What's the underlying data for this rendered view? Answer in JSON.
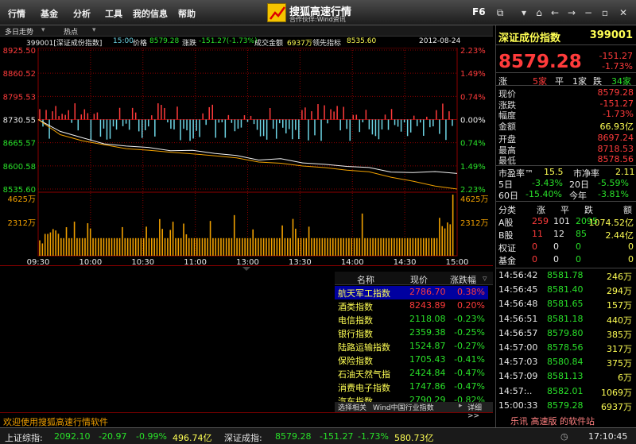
{
  "menu": [
    "行情",
    "基金",
    "分析",
    "工具",
    "我的信息",
    "帮助"
  ],
  "logo": {
    "name": "搜狐高速行情",
    "sub": "合作伙伴:Wind资讯"
  },
  "toolbar": {
    "f6": "F6"
  },
  "chart_header": {
    "tabs": [
      "多日走势",
      "热点"
    ]
  },
  "info": {
    "code_name": "399001[深证成份指数]",
    "time": "15:00",
    "price_label": "价格",
    "price": "8579.28",
    "change_label": "涨跌",
    "change": "-151.27(-1.73%)",
    "amount_label": "成交金额",
    "amount": "6937万",
    "lead_label": "领先指标",
    "lead": "8535.60",
    "date": "2012-08-24"
  },
  "chart_data": {
    "type": "line",
    "title": "",
    "xlabel": "",
    "ylabel": "",
    "y_ticks_left": [
      "8925.50",
      "8860.52",
      "8795.53",
      "8730.55",
      "8665.57",
      "8600.58",
      "8535.60"
    ],
    "y_ticks_right": [
      "2.23%",
      "1.49%",
      "0.74%",
      "0.00%",
      "0.74%",
      "1.49%",
      "2.23%"
    ],
    "ylim": [
      8535.6,
      8925.5
    ],
    "prev_close": 8730.55,
    "x_ticks": [
      "09:30",
      "10:00",
      "10:30",
      "11:00",
      "13:00",
      "13:30",
      "14:00",
      "14:30",
      "15:00"
    ],
    "volume_ticks": [
      "4625万",
      "2312万"
    ],
    "volume_ticks_right": [
      "4625万",
      "2312万"
    ],
    "volume_max": 6937,
    "series": [
      {
        "values": [
          8730.6,
          8697.3,
          8679.6,
          8662.4,
          8656.1,
          8652.3,
          8642.9,
          8644.3,
          8635.7,
          8629.7,
          8617.0,
          8620.6,
          8608.8,
          8604.9,
          8599.0,
          8596.0,
          8583.3,
          8582.0,
          8584.7,
          8579.3
        ]
      },
      {
        "values": [
          8730.6,
          8688.2,
          8671.0,
          8659.9,
          8648.7,
          8644.6,
          8638.9,
          8634.4,
          8628.9,
          8622.9,
          8611.4,
          8607.9,
          8600.2,
          8595.7,
          8588.6,
          8583.9,
          8568.7,
          8557.7,
          8543.9,
          8535.6
        ]
      }
    ],
    "volume": [
      1750,
      1400,
      2480,
      2480,
      2650,
      3030,
      2870,
      2500,
      2000,
      2000,
      3240,
      2000,
      2000,
      3870,
      2000,
      2000,
      2000,
      2000,
      3690,
      3100,
      2000,
      2000,
      2000,
      2000,
      2000,
      2000,
      2000,
      2000,
      2000,
      2000,
      2000,
      3250,
      2000,
      2000,
      2000,
      2000,
      2000,
      2000,
      2000,
      2000,
      3300,
      2000,
      2000,
      2000,
      2000,
      4160,
      3050,
      2000,
      2000,
      2930,
      3860,
      2000,
      2000,
      2000,
      3650,
      2430,
      2000,
      2000,
      2000,
      2000,
      2000,
      2000,
      2000,
      2000,
      3950,
      2000,
      2000,
      2000,
      2000,
      2000,
      2000,
      2000,
      2000,
      4610,
      2000,
      2000,
      2000,
      2000,
      2000,
      2000,
      2990,
      2000,
      2000,
      2000,
      2000,
      2000,
      2000,
      2000,
      2000,
      2000,
      2000,
      3440,
      2000,
      2000,
      2000,
      4180,
      3070,
      2000,
      2000,
      2000,
      2000,
      3300,
      2000,
      2000,
      2000,
      2000,
      2000,
      2000,
      2000,
      2000,
      2000,
      2000,
      2000,
      2000,
      2000,
      2000,
      2000,
      2000,
      2000,
      2000,
      2000,
      4790,
      2000,
      2000,
      2000,
      2000,
      2000,
      2000,
      2000,
      2000,
      2000,
      2000,
      2000,
      2000,
      2000,
      2000,
      2000,
      2000,
      2000,
      2000,
      2000,
      2000,
      2000,
      2000,
      2000,
      2000,
      2000,
      2000,
      2000,
      2000,
      4300,
      3360,
      3100,
      3780,
      3570,
      6937
    ],
    "updown_count": 130
  },
  "right": {
    "title": "深证成份指数",
    "code": "399001",
    "price": "8579.28",
    "change": "-151.27",
    "pct": "-1.73%",
    "breadth": {
      "up_label": "涨",
      "up": "5家",
      "flat_label": "平",
      "flat": "1家",
      "down_label": "跌",
      "down": "34家"
    },
    "quote": [
      {
        "k": "现价",
        "v": "8579.28",
        "c": "red"
      },
      {
        "k": "涨跌",
        "v": "-151.27",
        "c": "red"
      },
      {
        "k": "幅度",
        "v": "-1.73%",
        "c": "red"
      },
      {
        "k": "金额",
        "v": "66.93亿",
        "c": "yellow"
      },
      {
        "k": "开盘",
        "v": "8697.24",
        "c": "red"
      },
      {
        "k": "最高",
        "v": "8718.53",
        "c": "red"
      },
      {
        "k": "最低",
        "v": "8578.56",
        "c": "red"
      }
    ],
    "pe": {
      "pe_label": "市盈率™",
      "pe": "15.5",
      "pb_label": "市净率",
      "pb": "2.11"
    },
    "periods": [
      {
        "a_label": "5日",
        "a": "-3.43%",
        "b_label": "20日",
        "b": "-5.59%"
      },
      {
        "a_label": "60日",
        "a": "-15.40%",
        "b_label": "今年",
        "b": "-3.81%"
      }
    ],
    "market_header": [
      "分类",
      "涨",
      "平",
      "跌",
      "额"
    ],
    "market": [
      {
        "name": "A股",
        "up": "259",
        "flat": "101",
        "down": "2095",
        "amt": "1074.52亿"
      },
      {
        "name": "B股",
        "up": "11",
        "flat": "12",
        "down": "85",
        "amt": "2.44亿"
      },
      {
        "name": "权证",
        "up": "0",
        "flat": "0",
        "down": "0",
        "amt": "0"
      },
      {
        "name": "基金",
        "up": "0",
        "flat": "0",
        "down": "0",
        "amt": "0"
      }
    ],
    "ticks": [
      {
        "t": "14:56:42",
        "p": "8581.78",
        "v": "246万"
      },
      {
        "t": "14:56:45",
        "p": "8581.40",
        "v": "294万"
      },
      {
        "t": "14:56:48",
        "p": "8581.65",
        "v": "157万"
      },
      {
        "t": "14:56:51",
        "p": "8581.18",
        "v": "440万"
      },
      {
        "t": "14:56:57",
        "p": "8579.80",
        "v": "385万"
      },
      {
        "t": "14:57:00",
        "p": "8578.56",
        "v": "317万"
      },
      {
        "t": "14:57:03",
        "p": "8580.84",
        "v": "375万"
      },
      {
        "t": "14:57:09",
        "p": "8581.13",
        "v": "6万"
      },
      {
        "t": "14:57:..",
        "p": "8582.01",
        "v": "1069万"
      },
      {
        "t": "15:00:33",
        "p": "8579.28",
        "v": "6937万"
      }
    ],
    "bottom_note": "乐讯 高速版 的软件站"
  },
  "sector": {
    "headers": [
      "名称",
      "现价",
      "涨跌幅"
    ],
    "rows": [
      {
        "name": "航天军工指数",
        "price": "2786.70",
        "pct": "0.38%",
        "up": true
      },
      {
        "name": "酒类指数",
        "price": "8243.89",
        "pct": "0.20%",
        "up": true
      },
      {
        "name": "电信指数",
        "price": "2118.08",
        "pct": "-0.23%",
        "up": false
      },
      {
        "name": "银行指数",
        "price": "2359.38",
        "pct": "-0.25%",
        "up": false
      },
      {
        "name": "陆路运输指数",
        "price": "1524.87",
        "pct": "-0.27%",
        "up": false
      },
      {
        "name": "保险指数",
        "price": "1705.43",
        "pct": "-0.41%",
        "up": false
      },
      {
        "name": "石油天然气指",
        "price": "2424.84",
        "pct": "-0.47%",
        "up": false
      },
      {
        "name": "消费电子指数",
        "price": "1747.86",
        "pct": "-0.47%",
        "up": false
      },
      {
        "name": "汽车指数",
        "price": "2790.29",
        "pct": "-0.82%",
        "up": false
      }
    ],
    "tabs": [
      "选择相关",
      "Wind中国行业指数",
      "详细>>"
    ]
  },
  "welcome": "欢迎使用搜狐高速行情软件",
  "status": {
    "sh_label": "上证综指:",
    "sh_price": "2092.10",
    "sh_chg": "-20.97",
    "sh_pct": "-0.99%",
    "sh_amt": "496.74亿",
    "sz_label": "深证成指:",
    "sz_price": "8579.28",
    "sz_chg": "-151.27",
    "sz_pct": "-1.73%",
    "sz_amt": "580.73亿",
    "time": "17:10:45"
  },
  "colors": {
    "up": "#ff3b3b",
    "down": "#29e029",
    "yellow": "#ffff54",
    "cyan": "#6ed6e6",
    "orange": "#f0a000"
  }
}
